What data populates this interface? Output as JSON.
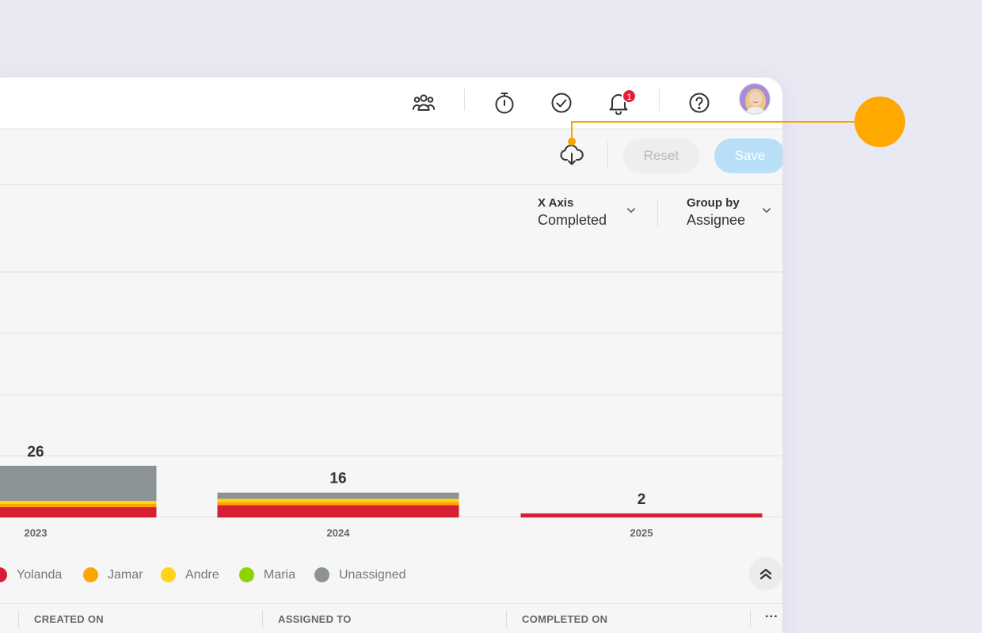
{
  "actions": {
    "reset_label": "Reset",
    "save_label": "Save"
  },
  "notifications": {
    "count": "1"
  },
  "controls": {
    "x_axis": {
      "label": "X Axis",
      "value": "Completed"
    },
    "group_by": {
      "label": "Group by",
      "value": "Assignee"
    }
  },
  "chart_data": {
    "type": "bar",
    "stacked": true,
    "categories": [
      "2023",
      "2024",
      "2025"
    ],
    "totals": [
      26,
      16,
      2
    ],
    "series": [
      {
        "name": "Yolanda",
        "color": "#d61f35",
        "values": [
          5,
          6,
          2
        ]
      },
      {
        "name": "Jamar",
        "color": "#ffa500",
        "values": [
          1,
          1,
          0
        ]
      },
      {
        "name": "Andre",
        "color": "#ffd31a",
        "values": [
          1,
          1,
          0
        ]
      },
      {
        "name": "Maria",
        "color": "#8ed200",
        "values": [
          0,
          0,
          0
        ]
      },
      {
        "name": "Unassigned",
        "color": "#8c9396",
        "values": [
          17,
          3,
          0
        ]
      }
    ],
    "grid": true
  },
  "legend": [
    {
      "name": "Yolanda",
      "color": "#d61f35"
    },
    {
      "name": "Jamar",
      "color": "#ffa500"
    },
    {
      "name": "Andre",
      "color": "#ffd31a"
    },
    {
      "name": "Maria",
      "color": "#8ed200"
    },
    {
      "name": "Unassigned",
      "color": "#8c9396"
    }
  ],
  "table": {
    "columns": [
      "CREATED ON",
      "ASSIGNED TO",
      "COMPLETED ON"
    ],
    "more_label": "···"
  },
  "icons": {
    "team": "team-icon",
    "timer": "stopwatch-icon",
    "tasks": "check-circle-icon",
    "bell": "bell-icon",
    "help": "help-icon",
    "export": "cloud-download-icon"
  }
}
